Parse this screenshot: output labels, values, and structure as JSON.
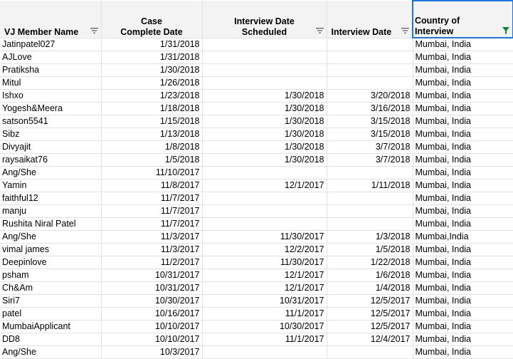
{
  "columns": [
    {
      "label": "VJ Member Name",
      "filter_icon": "filter-lines-icon"
    },
    {
      "label": "Case Complete Date",
      "filter_icon": null
    },
    {
      "label": "Interview Date Scheduled",
      "filter_icon": "filter-lines-icon"
    },
    {
      "label": "Interview Date",
      "filter_icon": "filter-lines-icon"
    },
    {
      "label": "Country of Interview",
      "filter_icon": "filter-funnel-icon",
      "filter_color": "#188038"
    }
  ],
  "rows": [
    [
      "Jatinpatel027",
      "1/31/2018",
      "",
      "",
      "Mumbai, India"
    ],
    [
      "AJLove",
      "1/31/2018",
      "",
      "",
      "Mumbai, India"
    ],
    [
      "Pratiksha",
      "1/30/2018",
      "",
      "",
      "Mumbai, India"
    ],
    [
      "Mitul",
      "1/26/2018",
      "",
      "",
      "Mumbai, India"
    ],
    [
      "Ishxo",
      "1/23/2018",
      "1/30/2018",
      "3/20/2018",
      "Mumbai, India"
    ],
    [
      "Yogesh&Meera",
      "1/18/2018",
      "1/30/2018",
      "3/16/2018",
      "Mumbai, India"
    ],
    [
      "satson5541",
      "1/15/2018",
      "1/30/2018",
      "3/15/2018",
      "Mumbai, India"
    ],
    [
      "Sibz",
      "1/13/2018",
      "1/30/2018",
      "3/15/2018",
      "Mumbai, India"
    ],
    [
      "Divyajit",
      "1/8/2018",
      "1/30/2018",
      "3/7/2018",
      "Mumbai, India"
    ],
    [
      "raysaikat76",
      "1/5/2018",
      "1/30/2018",
      "3/7/2018",
      "Mumbai, India"
    ],
    [
      "Ang/She",
      "11/10/2017",
      "",
      "",
      "Mumbai, India"
    ],
    [
      "Yamin",
      "11/8/2017",
      "12/1/2017",
      "1/11/2018",
      "Mumbai, India"
    ],
    [
      "faithful12",
      "11/7/2017",
      "",
      "",
      "Mumbai, India"
    ],
    [
      "manju",
      "11/7/2017",
      "",
      "",
      "Mumbai, India"
    ],
    [
      "Rushita Niral Patel",
      "11/7/2017",
      "",
      "",
      "Mumbai, India"
    ],
    [
      "Ang/She",
      "11/3/2017",
      "11/30/2017",
      "1/3/2018",
      "Mumbai,India"
    ],
    [
      "vimal james",
      "11/3/2017",
      "12/2/2017",
      "1/5/2018",
      "Mumbai, India"
    ],
    [
      "Deepinlove",
      "11/2/2017",
      "11/30/2017",
      "1/22/2018",
      "Mumbai, India"
    ],
    [
      "psham",
      "10/31/2017",
      "12/1/2017",
      "1/6/2018",
      "Mumbai, India"
    ],
    [
      "Ch&Am",
      "10/31/2017",
      "12/1/2017",
      "1/4/2018",
      "Mumbai, India"
    ],
    [
      "Siri7",
      "10/30/2017",
      "10/31/2017",
      "12/5/2017",
      "Mumbai, India"
    ],
    [
      "patel",
      "10/16/2017",
      "11/1/2017",
      "12/5/2017",
      "Mumbai, India"
    ],
    [
      "MumbaiApplicant",
      "10/10/2017",
      "10/30/2017",
      "12/5/2017",
      "Mumbai, India"
    ],
    [
      "DD8",
      "10/10/2017",
      "11/1/2017",
      "12/4/2017",
      "Mumbai, India"
    ],
    [
      "Ang/She",
      "10/3/2017",
      "",
      "",
      "Mumbai, India"
    ]
  ]
}
